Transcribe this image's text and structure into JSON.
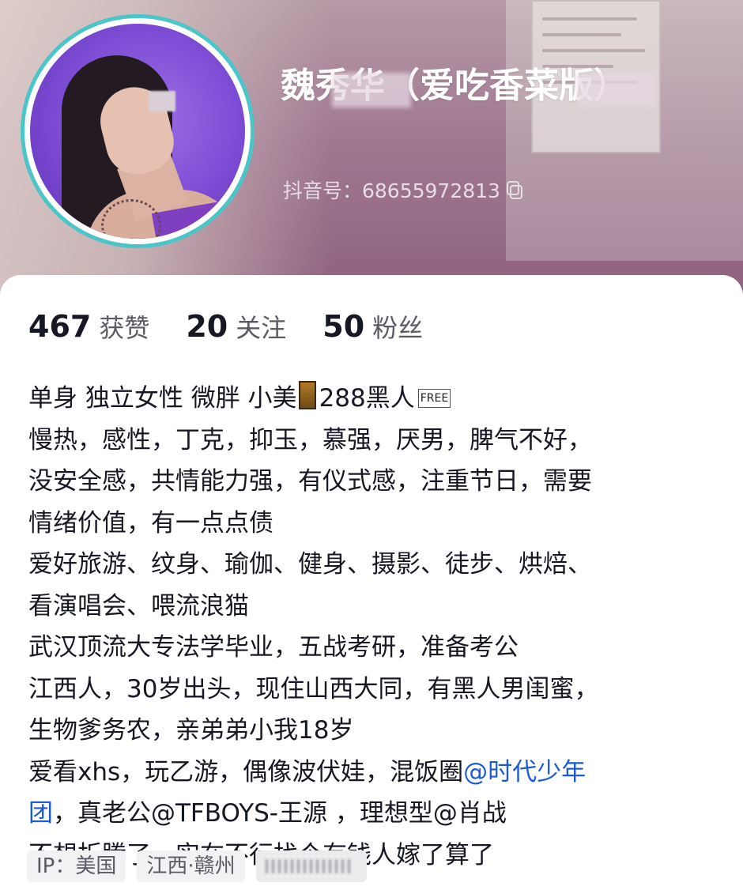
{
  "profile": {
    "name": "魏秀华（爱吃香菜版）",
    "douyin_id": "抖音号：68655972813",
    "accent_ring_color": "#4cc5c9"
  },
  "stats": [
    {
      "value": "467",
      "label": "获赞"
    },
    {
      "value": "20",
      "label": "关注"
    },
    {
      "value": "50",
      "label": "粉丝"
    }
  ],
  "bio": {
    "line1_a": "单身 独立女性 微胖 小美",
    "line1_b": "288黑人",
    "line1_free": "FREE",
    "line2": "慢热，感性，丁克，抑玉，慕强，厌男，脾气不好，",
    "line3": "没安全感，共情能力强，有仪式感，注重节日，需要",
    "line4": "情绪价值，有一点点债",
    "line5": "爱好旅游、纹身、瑜伽、健身、摄影、徒步、烘焙、",
    "line6": "看演唱会、喂流浪猫",
    "line7": "武汉顶流大专法学毕业，五战考研，准备考公",
    "line8": "江西人，30岁出头，现住山西大同，有黑人男闺蜜，",
    "line9": "生物爹务农，亲弟弟小我18岁",
    "line10_a": "爱看xhs，玩乙游，偶像波伏娃，混饭圈",
    "line10_link": "@时代少年",
    "line11_link_tail": "团",
    "line11_b": "，真老公@TFBOYS-王源 ，理想型@肖战",
    "line12": "不想折腾了，实在不行找个有钱人嫁了算了",
    "link_color": "#1c5ad6"
  },
  "tags": [
    {
      "label": "IP：美国"
    },
    {
      "label": "江西·赣州"
    }
  ]
}
